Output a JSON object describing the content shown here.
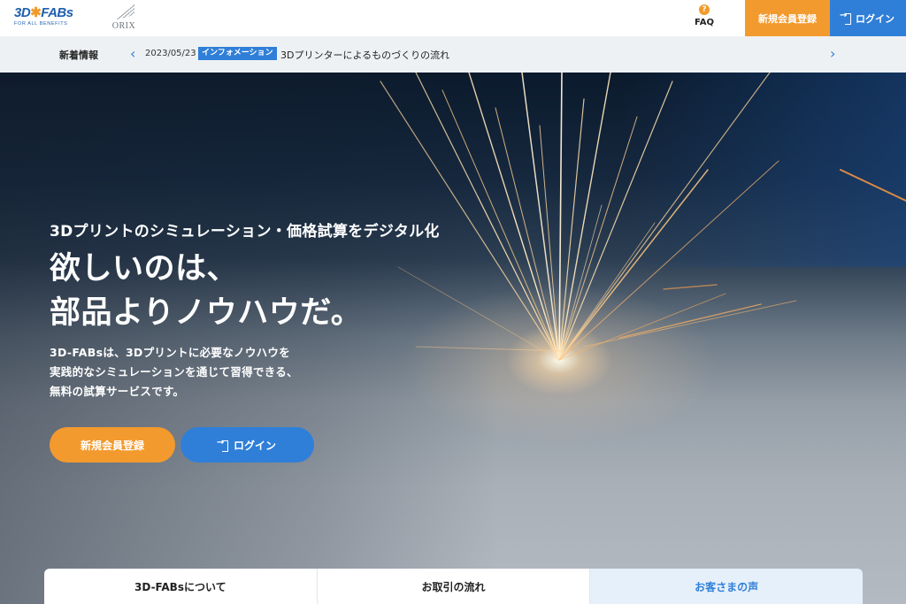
{
  "header": {
    "logo_text": "3D",
    "logo_text2": "FABs",
    "logo_sub": "FOR ALL BENEFITS",
    "orix_text": "ORIX",
    "faq_label": "FAQ",
    "faq_icon": "?",
    "register_label": "新規会員登録",
    "login_label": "ログイン"
  },
  "news": {
    "title": "新着情報",
    "date": "2023/05/23",
    "category": "インフォメーション",
    "text": "3Dプリンターによるものづくりの流れ"
  },
  "hero": {
    "subtitle": "3Dプリントのシミュレーション・価格試算をデジタル化",
    "title_line1": "欲しいのは、",
    "title_line2": "部品よりノウハウだ。",
    "desc_line1": "3D-FABsは、3Dプリントに必要なノウハウを",
    "desc_line2": "実践的なシミュレーションを通じて習得できる、",
    "desc_line3": "無料の試算サービスです。",
    "register_label": "新規会員登録",
    "login_label": "ログイン"
  },
  "tabs": [
    {
      "label": "3D-FABsについて"
    },
    {
      "label": "お取引の流れ"
    },
    {
      "label": "お客さまの声"
    }
  ],
  "colors": {
    "accent_orange": "#f39a2e",
    "accent_blue": "#2f7fd8",
    "logo_blue": "#1f5fae"
  }
}
